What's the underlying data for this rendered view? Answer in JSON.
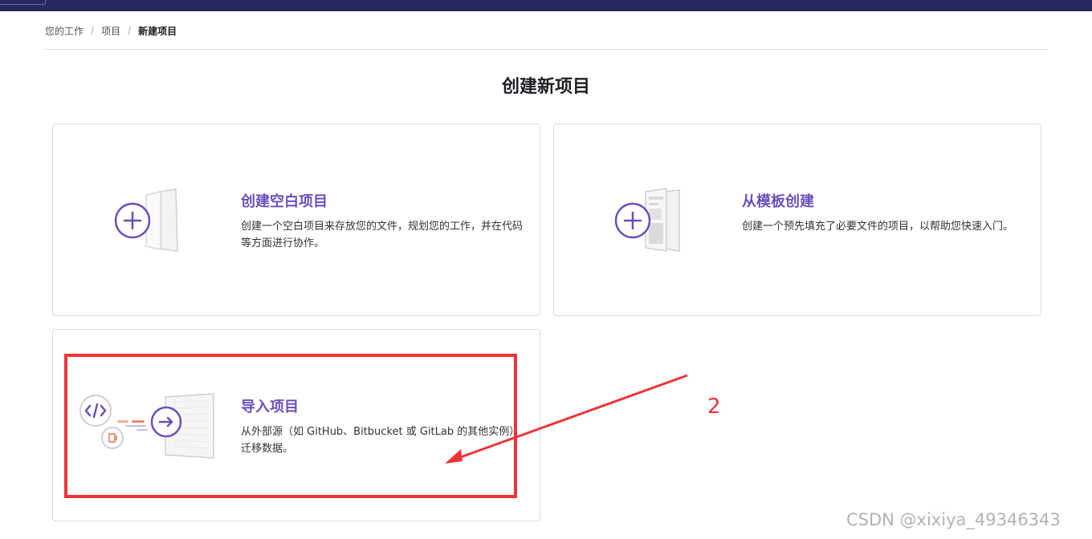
{
  "breadcrumb": {
    "items": [
      "您的工作",
      "项目"
    ],
    "separator": "/",
    "current": "新建项目"
  },
  "page": {
    "title": "创建新项目"
  },
  "cards": [
    {
      "title": "创建空白项目",
      "description": "创建一个空白项目来存放您的文件，规划您的工作，并在代码等方面进行协作。"
    },
    {
      "title": "从模板创建",
      "description": "创建一个预先填充了必要文件的项目，以帮助您快速入门。"
    },
    {
      "title": "导入项目",
      "description": "从外部源（如 GitHub、Bitbucket 或 GitLab 的其他实例）迁移数据。"
    }
  ],
  "annotation": {
    "number": "2"
  },
  "watermark": "CSDN @xixiya_49346343",
  "icons": [
    "plus-icon",
    "document-icon",
    "template-icon",
    "code-icon",
    "arrow-right-icon",
    "repository-icon"
  ],
  "colors": {
    "accent": "#6b4fbb",
    "topbar": "#292961",
    "annotation": "#ee3338",
    "border": "#dcdcde"
  }
}
